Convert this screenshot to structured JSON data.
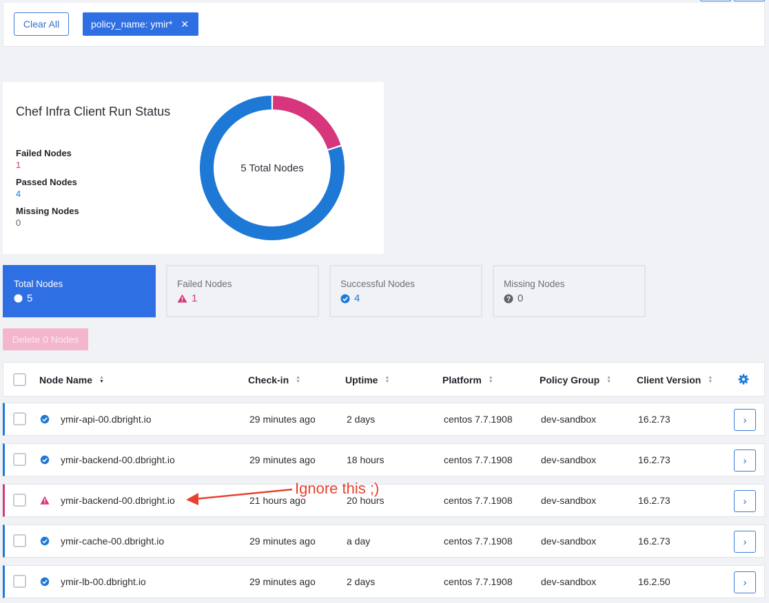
{
  "filters": {
    "clear_label": "Clear All",
    "chip_label": "policy_name: ymir*",
    "chip_close": "✕"
  },
  "status": {
    "title": "Chef Infra Client Run Status",
    "failed_label": "Failed Nodes",
    "failed_value": "1",
    "passed_label": "Passed Nodes",
    "passed_value": "4",
    "missing_label": "Missing Nodes",
    "missing_value": "0",
    "center_text": "5 Total Nodes"
  },
  "chart_data": {
    "type": "pie",
    "categories": [
      "Failed",
      "Passed",
      "Missing"
    ],
    "values": [
      1,
      4,
      0
    ],
    "colors": [
      "#d7367c",
      "#1d78d6",
      "#9aa0a6"
    ],
    "title": ""
  },
  "tiles": [
    {
      "label": "Total Nodes",
      "value": "5",
      "icon": "circle-icon"
    },
    {
      "label": "Failed Nodes",
      "value": "1",
      "icon": "warning-icon"
    },
    {
      "label": "Successful Nodes",
      "value": "4",
      "icon": "check-circle-icon"
    },
    {
      "label": "Missing Nodes",
      "value": "0",
      "icon": "question-circle-icon"
    }
  ],
  "delete_label": "Delete 0 Nodes",
  "table": {
    "headers": {
      "name": "Node Name",
      "checkin": "Check-in",
      "uptime": "Uptime",
      "platform": "Platform",
      "policy_group": "Policy Group",
      "client_version": "Client Version"
    },
    "rows": [
      {
        "status": "passed",
        "name": "ymir-api-00.dbright.io",
        "checkin": "29 minutes ago",
        "uptime": "2 days",
        "platform": "centos 7.7.1908",
        "policy_group": "dev-sandbox",
        "client_version": "16.2.73"
      },
      {
        "status": "passed",
        "name": "ymir-backend-00.dbright.io",
        "checkin": "29 minutes ago",
        "uptime": "18 hours",
        "platform": "centos 7.7.1908",
        "policy_group": "dev-sandbox",
        "client_version": "16.2.73"
      },
      {
        "status": "failed",
        "name": "ymir-backend-00.dbright.io",
        "checkin": "21 hours ago",
        "uptime": "20 hours",
        "platform": "centos 7.7.1908",
        "policy_group": "dev-sandbox",
        "client_version": "16.2.73"
      },
      {
        "status": "passed",
        "name": "ymir-cache-00.dbright.io",
        "checkin": "29 minutes ago",
        "uptime": "a day",
        "platform": "centos 7.7.1908",
        "policy_group": "dev-sandbox",
        "client_version": "16.2.73"
      },
      {
        "status": "passed",
        "name": "ymir-lb-00.dbright.io",
        "checkin": "29 minutes ago",
        "uptime": "2 days",
        "platform": "centos 7.7.1908",
        "policy_group": "dev-sandbox",
        "client_version": "16.2.50"
      }
    ],
    "row_action": "›"
  },
  "annotation": "Ignore this ;)"
}
